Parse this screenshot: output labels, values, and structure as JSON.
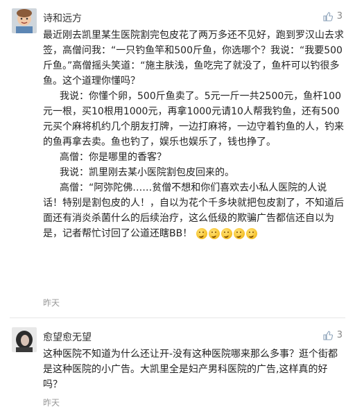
{
  "comments": [
    {
      "username": "诗和远方",
      "likes": "3",
      "paragraphs": [
        "最近刚去凯里某生医院割完包皮花了两万多还不见好，跑到罗汉山去求签，高僧问我：“一只钓鱼竿和500斤鱼，你选哪个？我说：“我要500斤鱼。”高僧摇头笑道：“施主肤浅，鱼吃完了就没了，鱼杆可以钓很多鱼。这个道理你懂吗？",
        "我说：你懂个卵，500斤鱼卖了。5元一斤一共2500元，鱼杆100元一根，买10根用1000元，再拿1000元请10人帮我钓鱼，还有500元买个麻将机约几个朋友打牌，一边打麻将，一边守着钓鱼的人，钓来的鱼再拿去卖。鱼也钓了，娱乐也娱乐了，钱也挣了。",
        "高僧：你是哪里的香客？",
        "我说：凯里刚去某小医院割包皮回来的。",
        "高僧：“阿弥陀佛……贫僧不想和你们喜欢去小私人医院的人说话！特别是割包皮的人！，自以为花个千多块就把包皮割了，不知道后面还有消炎杀菌什么的后续治疗，这么低级的欺骗广告都信还自以为是，记者帮忙讨回了公道还瞎BB！"
      ],
      "time": "昨天"
    },
    {
      "username": "愈望愈无望",
      "likes": "3",
      "paragraphs": [
        "这种医院不知道为什么还让开-没有这种医院哪来那么多事？逛个街都是这种医院的小广告。大凯里全是妇产男科医院的广告,这样真的好吗？"
      ],
      "time": "昨天"
    }
  ],
  "icons": {
    "like": "thumbs-up-icon",
    "emoji": "thinking-face-emoji"
  },
  "colors": {
    "text": "#222222",
    "meta": "#999999",
    "like": "#888888"
  }
}
